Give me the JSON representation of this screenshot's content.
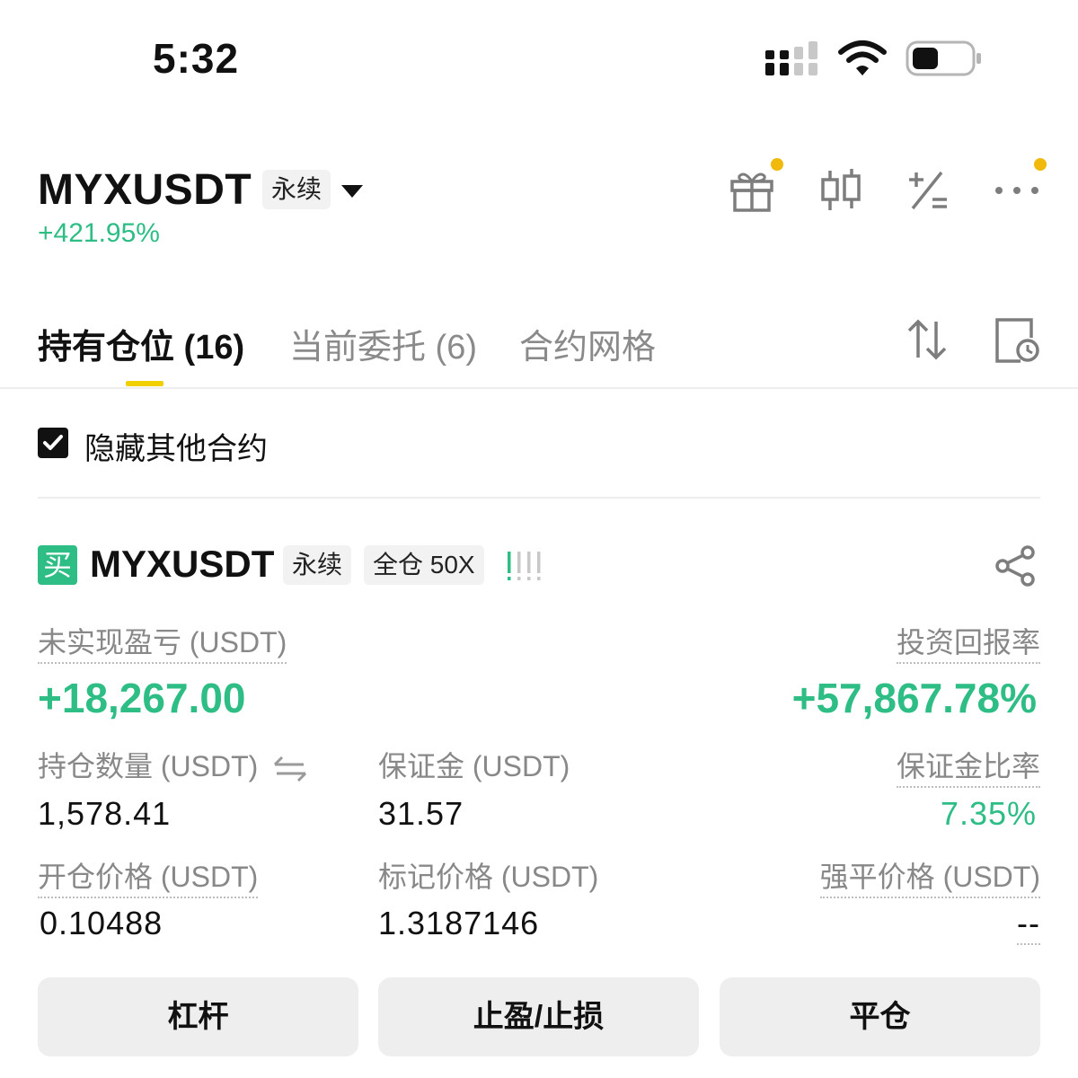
{
  "status_bar": {
    "time": "5:32"
  },
  "header": {
    "symbol": "MYXUSDT",
    "contract_type": "永续",
    "price_change": "+421.95%",
    "icons": [
      "gift-icon",
      "candlestick-icon",
      "calculator-icon",
      "more-icon"
    ],
    "notification_dot_color": "#f0b90b"
  },
  "tabs": [
    {
      "label": "持有仓位 (16)",
      "active": true
    },
    {
      "label": "当前委托 (6)",
      "active": false
    },
    {
      "label": "合约网格",
      "active": false
    }
  ],
  "tab_icons": [
    "sort-icon",
    "history-icon"
  ],
  "filter": {
    "hide_other_label": "隐藏其他合约",
    "checked": true
  },
  "position": {
    "side": "买",
    "symbol": "MYXUSDT",
    "contract_type": "永续",
    "margin_mode": "全仓 50X",
    "risk_indicator": "!!!!",
    "unrealized_pnl_label": "未实现盈亏 (USDT)",
    "unrealized_pnl": "+18,267.00",
    "roi_label": "投资回报率",
    "roi": "+57,867.78%",
    "size_label": "持仓数量 (USDT)",
    "size": "1,578.41",
    "margin_label": "保证金 (USDT)",
    "margin": "31.57",
    "margin_ratio_label": "保证金比率",
    "margin_ratio": "7.35%",
    "entry_price_label": "开仓价格 (USDT)",
    "entry_price": "0.10488",
    "mark_price_label": "标记价格 (USDT)",
    "mark_price": "1.3187146",
    "liq_price_label": "强平价格 (USDT)",
    "liq_price": "--"
  },
  "actions": {
    "leverage": "杠杆",
    "tp_sl": "止盈/止损",
    "close": "平仓"
  },
  "colors": {
    "positive": "#2ebd85",
    "accent": "#f0d000"
  }
}
